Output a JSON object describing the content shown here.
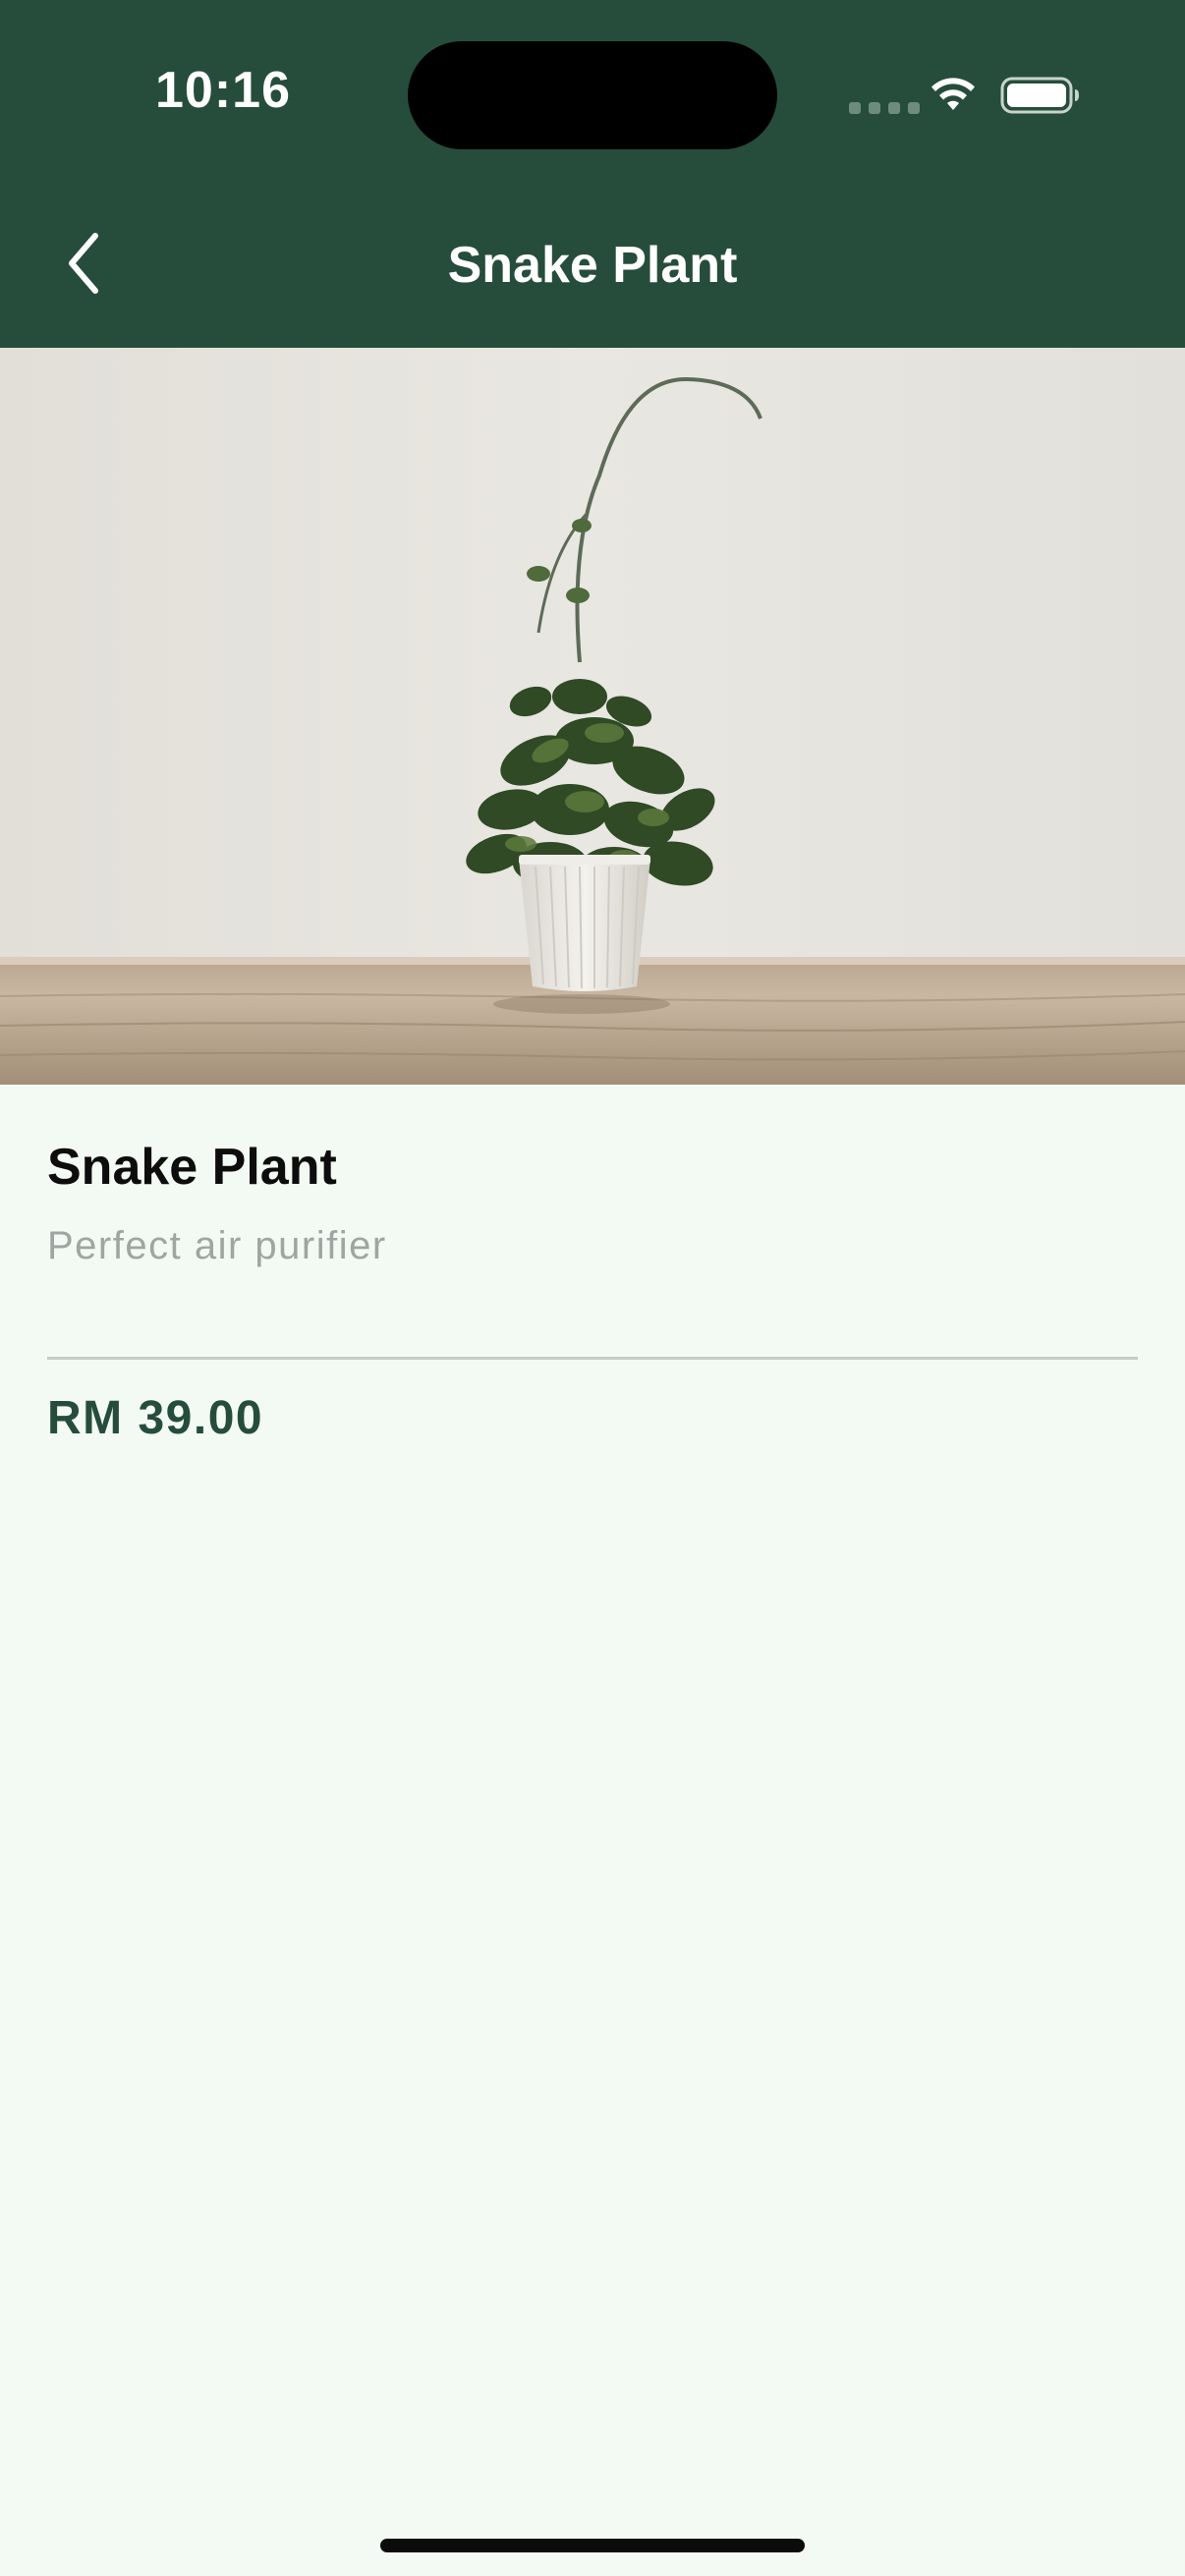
{
  "status_bar": {
    "time": "10:16",
    "icons": [
      "cellular-signal-icon",
      "wifi-icon",
      "battery-icon"
    ]
  },
  "nav": {
    "title": "Snake Plant",
    "back_icon": "chevron-left-icon"
  },
  "hero": {
    "image": "potted plant photo"
  },
  "product": {
    "name": "Snake Plant",
    "description": "Perfect air purifier",
    "price": "RM 39.00"
  },
  "colors": {
    "header_bg": "#264d3b",
    "page_bg": "#f3faf3",
    "price_text": "#264d3b",
    "description_text": "#a0a4a2"
  }
}
